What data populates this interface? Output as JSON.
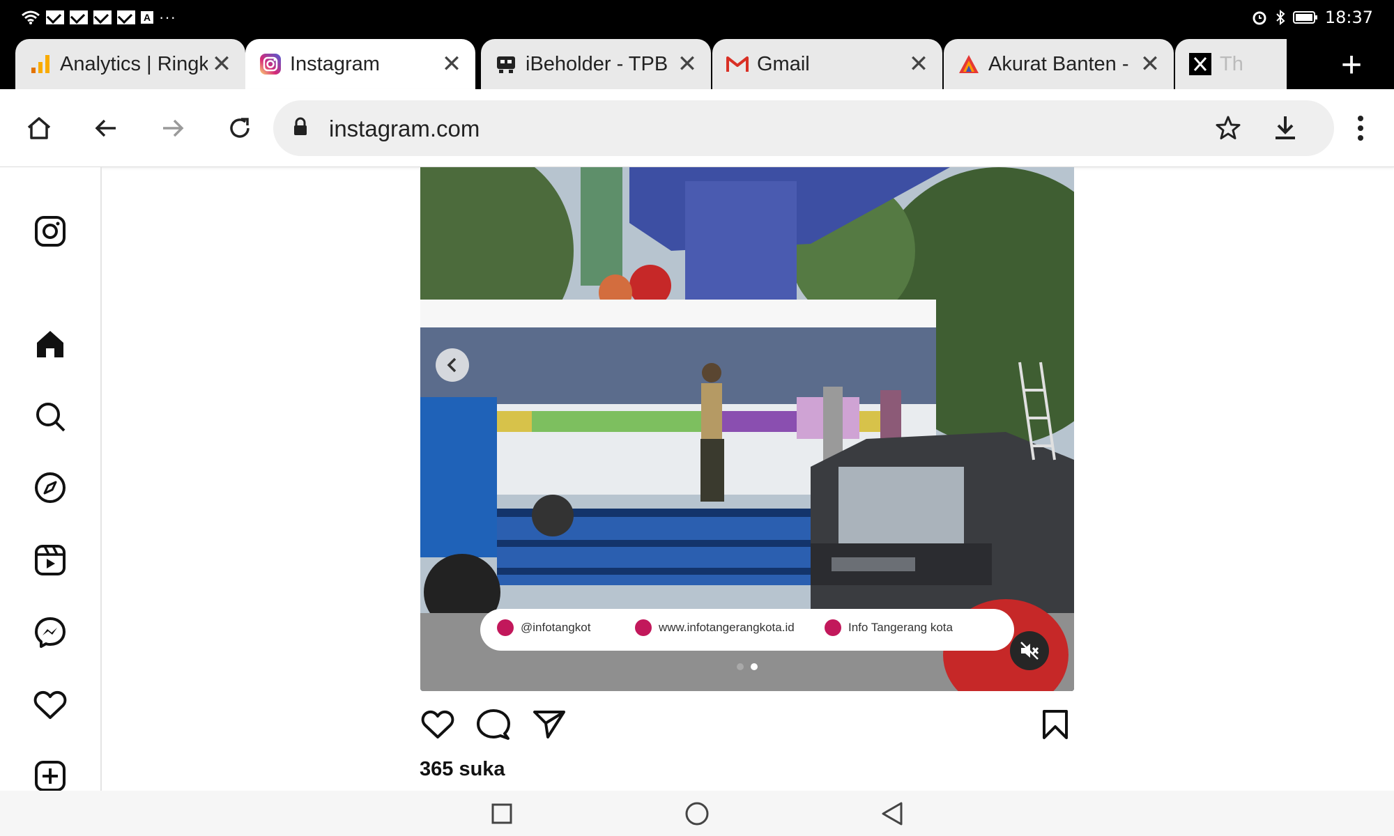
{
  "status_bar": {
    "time": "18:37",
    "left_icons": [
      "wifi-icon",
      "mail-icon",
      "mail-icon",
      "mail-icon",
      "mail-icon",
      "app-a-icon"
    ],
    "more": "···"
  },
  "tabs": [
    {
      "title": "Analytics | Ringk",
      "favicon": "analytics-icon",
      "active": false
    },
    {
      "title": "Instagram",
      "favicon": "instagram-icon",
      "active": true
    },
    {
      "title": "iBeholder - TPB",
      "favicon": "ibeholder-icon",
      "active": false
    },
    {
      "title": "Gmail",
      "favicon": "gmail-icon",
      "active": false
    },
    {
      "title": "Akurat Banten -",
      "favicon": "akurat-icon",
      "active": false
    },
    {
      "title": "Th",
      "favicon": "x-icon",
      "active": false
    }
  ],
  "new_tab_label": "+",
  "toolbar": {
    "url": "instagram.com"
  },
  "post": {
    "watermark": {
      "tiktok": "@infotangkot",
      "web": "www.infotangerangkota.id",
      "youtube": "Info Tangerang kota"
    },
    "slide_count": 2,
    "active_slide": 2,
    "likes": "365 suka"
  },
  "colors": {
    "instagram_gradient": [
      "#feda75",
      "#fa7e1e",
      "#d62976",
      "#962fbf",
      "#4f5bd5"
    ],
    "gmail_red": "#d93025",
    "analytics_orange": "#f9ab00",
    "akurat_red": "#e53935"
  }
}
